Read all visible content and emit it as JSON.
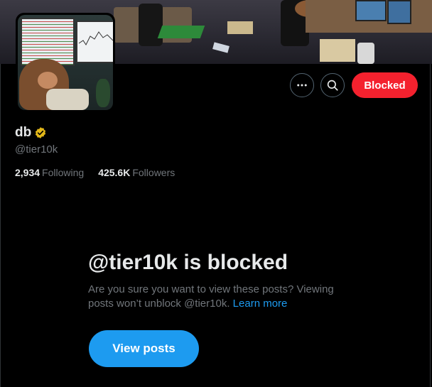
{
  "profile": {
    "display_name": "db",
    "handle": "@tier10k",
    "following_count": "2,934",
    "following_label": "Following",
    "followers_count": "425.6K",
    "followers_label": "Followers",
    "verified_color": "#e2b719"
  },
  "actions": {
    "more_icon": "more-horizontal-icon",
    "search_icon": "search-icon",
    "blocked_label": "Blocked",
    "blocked_color": "#f4212e"
  },
  "blocked_notice": {
    "title": "@tier10k is blocked",
    "description": "Are you sure you want to view these posts? Viewing posts won’t unblock @tier10k.",
    "learn_more": "Learn more",
    "view_posts_label": "View posts",
    "accent_color": "#1d9bf0"
  }
}
